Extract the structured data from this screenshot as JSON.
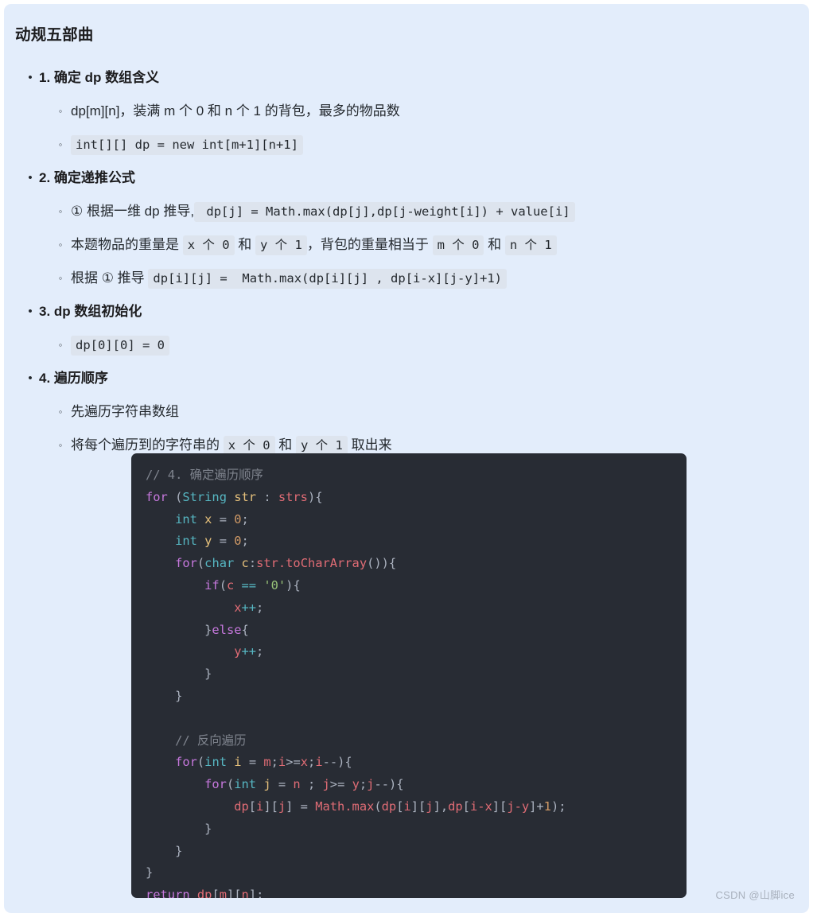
{
  "document": {
    "title": "动规五部曲",
    "background_color": "#e3edfb",
    "text_color": "#24292e"
  },
  "bullets": {
    "level1_marker": "•",
    "level2_marker": "◦"
  },
  "sections": [
    {
      "heading": "1. 确定 dp 数组含义",
      "items": [
        {
          "type": "text",
          "text": "dp[m][n]，装满 m 个 0 和 n 个 1 的背包，最多的物品数"
        },
        {
          "type": "code",
          "text": "int[][] dp = new int[m+1][n+1]"
        }
      ]
    },
    {
      "heading": "2. 确定递推公式",
      "items": [
        {
          "type": "mixed",
          "parts": [
            {
              "kind": "text",
              "text": "① 根据一维 dp 推导,"
            },
            {
              "kind": "code",
              "text": " dp[j] = Math.max(dp[j],dp[j-weight[i]) + value[i]"
            }
          ]
        },
        {
          "type": "mixed",
          "parts": [
            {
              "kind": "text",
              "text": "本题物品的重量是 "
            },
            {
              "kind": "code",
              "text": "x 个 0"
            },
            {
              "kind": "text",
              "text": " 和 "
            },
            {
              "kind": "code",
              "text": "y 个 1"
            },
            {
              "kind": "text",
              "text": "，背包的重量相当于 "
            },
            {
              "kind": "code",
              "text": "m 个 0"
            },
            {
              "kind": "text",
              "text": " 和 "
            },
            {
              "kind": "code",
              "text": "n 个 1"
            }
          ]
        },
        {
          "type": "mixed",
          "parts": [
            {
              "kind": "text",
              "text": "根据 ① 推导 "
            },
            {
              "kind": "code",
              "text": "dp[i][j] =  Math.max(dp[i][j] , dp[i-x][j-y]+1)"
            }
          ]
        }
      ]
    },
    {
      "heading": "3. dp 数组初始化",
      "items": [
        {
          "type": "code",
          "text": "dp[0][0] = 0"
        }
      ]
    },
    {
      "heading": "4. 遍历顺序",
      "items": [
        {
          "type": "text",
          "text": "先遍历字符串数组"
        },
        {
          "type": "mixed",
          "parts": [
            {
              "kind": "text",
              "text": "将每个遍历到的字符串的 "
            },
            {
              "kind": "code",
              "text": "x 个 0"
            },
            {
              "kind": "text",
              "text": " 和 "
            },
            {
              "kind": "code",
              "text": "y 个 1"
            },
            {
              "kind": "text",
              "text": " 取出来"
            }
          ]
        }
      ]
    }
  ],
  "code_block": {
    "language": "java",
    "background_color": "#282c34",
    "lines": [
      [
        {
          "t": "// 4. 确定遍历顺序",
          "c": "c-com"
        }
      ],
      [
        {
          "t": "for",
          "c": "c-key"
        },
        {
          "t": " (",
          "c": "c-pun"
        },
        {
          "t": "String",
          "c": "c-type"
        },
        {
          "t": " ",
          "c": "c-pun"
        },
        {
          "t": "str",
          "c": "c-var"
        },
        {
          "t": " : ",
          "c": "c-pun"
        },
        {
          "t": "strs",
          "c": "c-fn"
        },
        {
          "t": "){",
          "c": "c-pun"
        }
      ],
      [
        {
          "t": "    ",
          "c": "c-pun"
        },
        {
          "t": "int",
          "c": "c-type"
        },
        {
          "t": " ",
          "c": "c-pun"
        },
        {
          "t": "x",
          "c": "c-var"
        },
        {
          "t": " = ",
          "c": "c-pun"
        },
        {
          "t": "0",
          "c": "c-num"
        },
        {
          "t": ";",
          "c": "c-pun"
        }
      ],
      [
        {
          "t": "    ",
          "c": "c-pun"
        },
        {
          "t": "int",
          "c": "c-type"
        },
        {
          "t": " ",
          "c": "c-pun"
        },
        {
          "t": "y",
          "c": "c-var"
        },
        {
          "t": " = ",
          "c": "c-pun"
        },
        {
          "t": "0",
          "c": "c-num"
        },
        {
          "t": ";",
          "c": "c-pun"
        }
      ],
      [
        {
          "t": "    ",
          "c": "c-pun"
        },
        {
          "t": "for",
          "c": "c-key"
        },
        {
          "t": "(",
          "c": "c-pun"
        },
        {
          "t": "char",
          "c": "c-type"
        },
        {
          "t": " ",
          "c": "c-pun"
        },
        {
          "t": "c",
          "c": "c-var"
        },
        {
          "t": ":",
          "c": "c-pun"
        },
        {
          "t": "str.toCharArray",
          "c": "c-fn"
        },
        {
          "t": "()){",
          "c": "c-pun"
        }
      ],
      [
        {
          "t": "        ",
          "c": "c-pun"
        },
        {
          "t": "if",
          "c": "c-key"
        },
        {
          "t": "(",
          "c": "c-pun"
        },
        {
          "t": "c",
          "c": "c-fn"
        },
        {
          "t": " ",
          "c": "c-pun"
        },
        {
          "t": "==",
          "c": "c-op"
        },
        {
          "t": " ",
          "c": "c-pun"
        },
        {
          "t": "'0'",
          "c": "c-str"
        },
        {
          "t": "){",
          "c": "c-pun"
        }
      ],
      [
        {
          "t": "            ",
          "c": "c-pun"
        },
        {
          "t": "x",
          "c": "c-fn"
        },
        {
          "t": "++",
          "c": "c-op"
        },
        {
          "t": ";",
          "c": "c-pun"
        }
      ],
      [
        {
          "t": "        }",
          "c": "c-pun"
        },
        {
          "t": "else",
          "c": "c-key"
        },
        {
          "t": "{",
          "c": "c-pun"
        }
      ],
      [
        {
          "t": "            ",
          "c": "c-pun"
        },
        {
          "t": "y",
          "c": "c-fn"
        },
        {
          "t": "++",
          "c": "c-op"
        },
        {
          "t": ";",
          "c": "c-pun"
        }
      ],
      [
        {
          "t": "        }",
          "c": "c-pun"
        }
      ],
      [
        {
          "t": "    }",
          "c": "c-pun"
        }
      ],
      [
        {
          "t": "",
          "c": "c-pun"
        }
      ],
      [
        {
          "t": "    // 反向遍历",
          "c": "c-com"
        }
      ],
      [
        {
          "t": "    ",
          "c": "c-pun"
        },
        {
          "t": "for",
          "c": "c-key"
        },
        {
          "t": "(",
          "c": "c-pun"
        },
        {
          "t": "int",
          "c": "c-type"
        },
        {
          "t": " ",
          "c": "c-pun"
        },
        {
          "t": "i",
          "c": "c-var"
        },
        {
          "t": " = ",
          "c": "c-pun"
        },
        {
          "t": "m",
          "c": "c-fn"
        },
        {
          "t": ";",
          "c": "c-pun"
        },
        {
          "t": "i",
          "c": "c-fn"
        },
        {
          "t": ">=",
          "c": "c-pun"
        },
        {
          "t": "x",
          "c": "c-fn"
        },
        {
          "t": ";",
          "c": "c-pun"
        },
        {
          "t": "i",
          "c": "c-fn"
        },
        {
          "t": "--){",
          "c": "c-pun"
        }
      ],
      [
        {
          "t": "        ",
          "c": "c-pun"
        },
        {
          "t": "for",
          "c": "c-key"
        },
        {
          "t": "(",
          "c": "c-pun"
        },
        {
          "t": "int",
          "c": "c-type"
        },
        {
          "t": " ",
          "c": "c-pun"
        },
        {
          "t": "j",
          "c": "c-var"
        },
        {
          "t": " = ",
          "c": "c-pun"
        },
        {
          "t": "n",
          "c": "c-fn"
        },
        {
          "t": " ; ",
          "c": "c-pun"
        },
        {
          "t": "j",
          "c": "c-fn"
        },
        {
          "t": ">= ",
          "c": "c-pun"
        },
        {
          "t": "y",
          "c": "c-fn"
        },
        {
          "t": ";",
          "c": "c-pun"
        },
        {
          "t": "j",
          "c": "c-fn"
        },
        {
          "t": "--){",
          "c": "c-pun"
        }
      ],
      [
        {
          "t": "            ",
          "c": "c-pun"
        },
        {
          "t": "dp",
          "c": "c-fn"
        },
        {
          "t": "[",
          "c": "c-pun"
        },
        {
          "t": "i",
          "c": "c-fn"
        },
        {
          "t": "][",
          "c": "c-pun"
        },
        {
          "t": "j",
          "c": "c-fn"
        },
        {
          "t": "] = ",
          "c": "c-pun"
        },
        {
          "t": "Math.max",
          "c": "c-fn"
        },
        {
          "t": "(",
          "c": "c-pun"
        },
        {
          "t": "dp",
          "c": "c-fn"
        },
        {
          "t": "[",
          "c": "c-pun"
        },
        {
          "t": "i",
          "c": "c-fn"
        },
        {
          "t": "][",
          "c": "c-pun"
        },
        {
          "t": "j",
          "c": "c-fn"
        },
        {
          "t": "],",
          "c": "c-pun"
        },
        {
          "t": "dp",
          "c": "c-fn"
        },
        {
          "t": "[",
          "c": "c-pun"
        },
        {
          "t": "i-x",
          "c": "c-fn"
        },
        {
          "t": "][",
          "c": "c-pun"
        },
        {
          "t": "j-y",
          "c": "c-fn"
        },
        {
          "t": "]+",
          "c": "c-pun"
        },
        {
          "t": "1",
          "c": "c-num"
        },
        {
          "t": ");",
          "c": "c-pun"
        }
      ],
      [
        {
          "t": "        }",
          "c": "c-pun"
        }
      ],
      [
        {
          "t": "    }",
          "c": "c-pun"
        }
      ],
      [
        {
          "t": "}",
          "c": "c-pun"
        }
      ],
      [
        {
          "t": "return",
          "c": "c-key"
        },
        {
          "t": " ",
          "c": "c-pun"
        },
        {
          "t": "dp",
          "c": "c-fn"
        },
        {
          "t": "[",
          "c": "c-pun"
        },
        {
          "t": "m",
          "c": "c-fn"
        },
        {
          "t": "][",
          "c": "c-pun"
        },
        {
          "t": "n",
          "c": "c-fn"
        },
        {
          "t": "];",
          "c": "c-pun"
        }
      ]
    ]
  },
  "watermark": {
    "text": "CSDN @山脚ice"
  }
}
